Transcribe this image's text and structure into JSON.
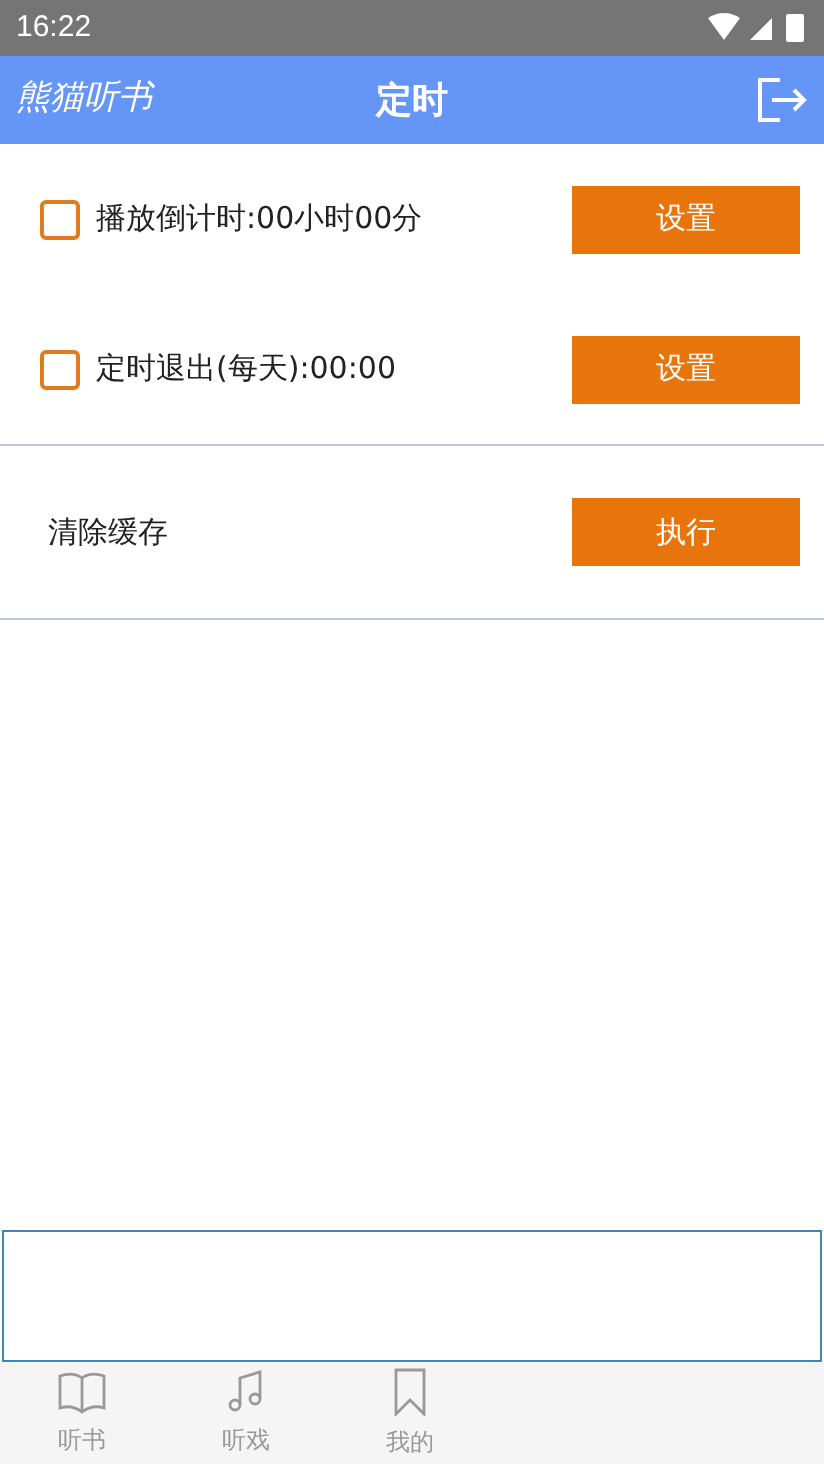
{
  "status_bar": {
    "time": "16:22"
  },
  "header": {
    "app_name": "熊猫听书",
    "title": "定时"
  },
  "timer_rows": [
    {
      "label": "播放倒计时:00小时00分",
      "checked": false,
      "button": "设置"
    },
    {
      "label": "定时退出(每天):00:00",
      "checked": false,
      "button": "设置"
    }
  ],
  "cache_row": {
    "label": "清除缓存",
    "button": "执行"
  },
  "tabs": [
    {
      "label": "听书",
      "kind": "book",
      "selected": false
    },
    {
      "label": "听戏",
      "kind": "music",
      "selected": false
    },
    {
      "label": "我的",
      "kind": "bookmark",
      "selected": false
    }
  ]
}
